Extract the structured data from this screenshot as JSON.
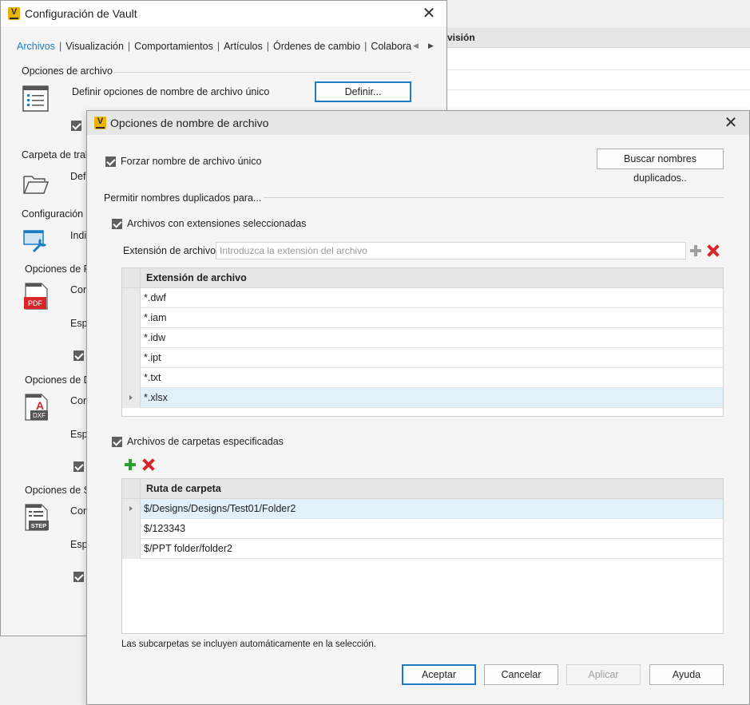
{
  "background_app": {
    "column_header": "visión"
  },
  "vault_window": {
    "title": "Configuración de Vault",
    "close_glyph": "✕",
    "logo_letter": "V",
    "tabs": [
      {
        "label": "Archivos",
        "active": true
      },
      {
        "label": "Visualización",
        "active": false
      },
      {
        "label": "Comportamientos",
        "active": false
      },
      {
        "label": "Artículos",
        "active": false
      },
      {
        "label": "Órdenes de cambio",
        "active": false
      },
      {
        "label": "Colabora",
        "active": false
      }
    ],
    "tab_separator": "|",
    "groups": {
      "file_options_title": "Opciones de archivo",
      "unique_name_label": "Definir opciones de nombre de archivo único",
      "define_button": "Definir...",
      "workfolder_title": "Carpeta de trab",
      "workfolder_label": "Defi",
      "config_title": "Configuración",
      "config_label": "Indi",
      "pdf_title": "Opciones de P",
      "pdf_label_1": "Con",
      "pdf_label_2": "Esp",
      "dxf_title": "Opciones de D",
      "dxf_label_1": "Con",
      "dxf_label_2": "Esp",
      "step_title": "Opciones de ST",
      "step_label_1": "Con",
      "step_label_2": "Esp"
    },
    "icon_texts": {
      "pdf": "PDF",
      "dxf": "DXF",
      "dxf_letter": "A",
      "step": "STEP"
    }
  },
  "dialog": {
    "title": "Opciones de nombre de archivo",
    "logo_letter": "V",
    "close_glyph": "✕",
    "force_unique_label": "Forzar nombre de archivo único",
    "force_unique_checked": true,
    "find_duplicates_button": "Buscar nombres duplicados..",
    "allow_duplicates_title": "Permitir nombres duplicados para...",
    "selected_extensions_label": "Archivos con extensiones seleccionadas",
    "selected_extensions_checked": true,
    "extension_field_label": "Extensión de archivo:",
    "extension_field_placeholder": "Introduzca la extensión del archivo",
    "extension_field_value": "",
    "extensions_grid": {
      "header": "Extensión de archivo",
      "rows": [
        "*.dwf",
        "*.iam",
        "*.idw",
        "*.ipt",
        "*.txt",
        "*.xlsx"
      ],
      "selected_index": 5
    },
    "specified_folders_label": "Archivos de carpetas especificadas",
    "specified_folders_checked": true,
    "folders_grid": {
      "header": "Ruta de carpeta",
      "rows": [
        "$/Designs/Designs/Test01/Folder2",
        "$/123343",
        "$/PPT folder/folder2"
      ],
      "selected_index": 0
    },
    "subfolders_note": "Las subcarpetas se incluyen automáticamente en la selección.",
    "buttons": {
      "ok": "Aceptar",
      "cancel": "Cancelar",
      "apply": "Aplicar",
      "help": "Ayuda"
    }
  }
}
